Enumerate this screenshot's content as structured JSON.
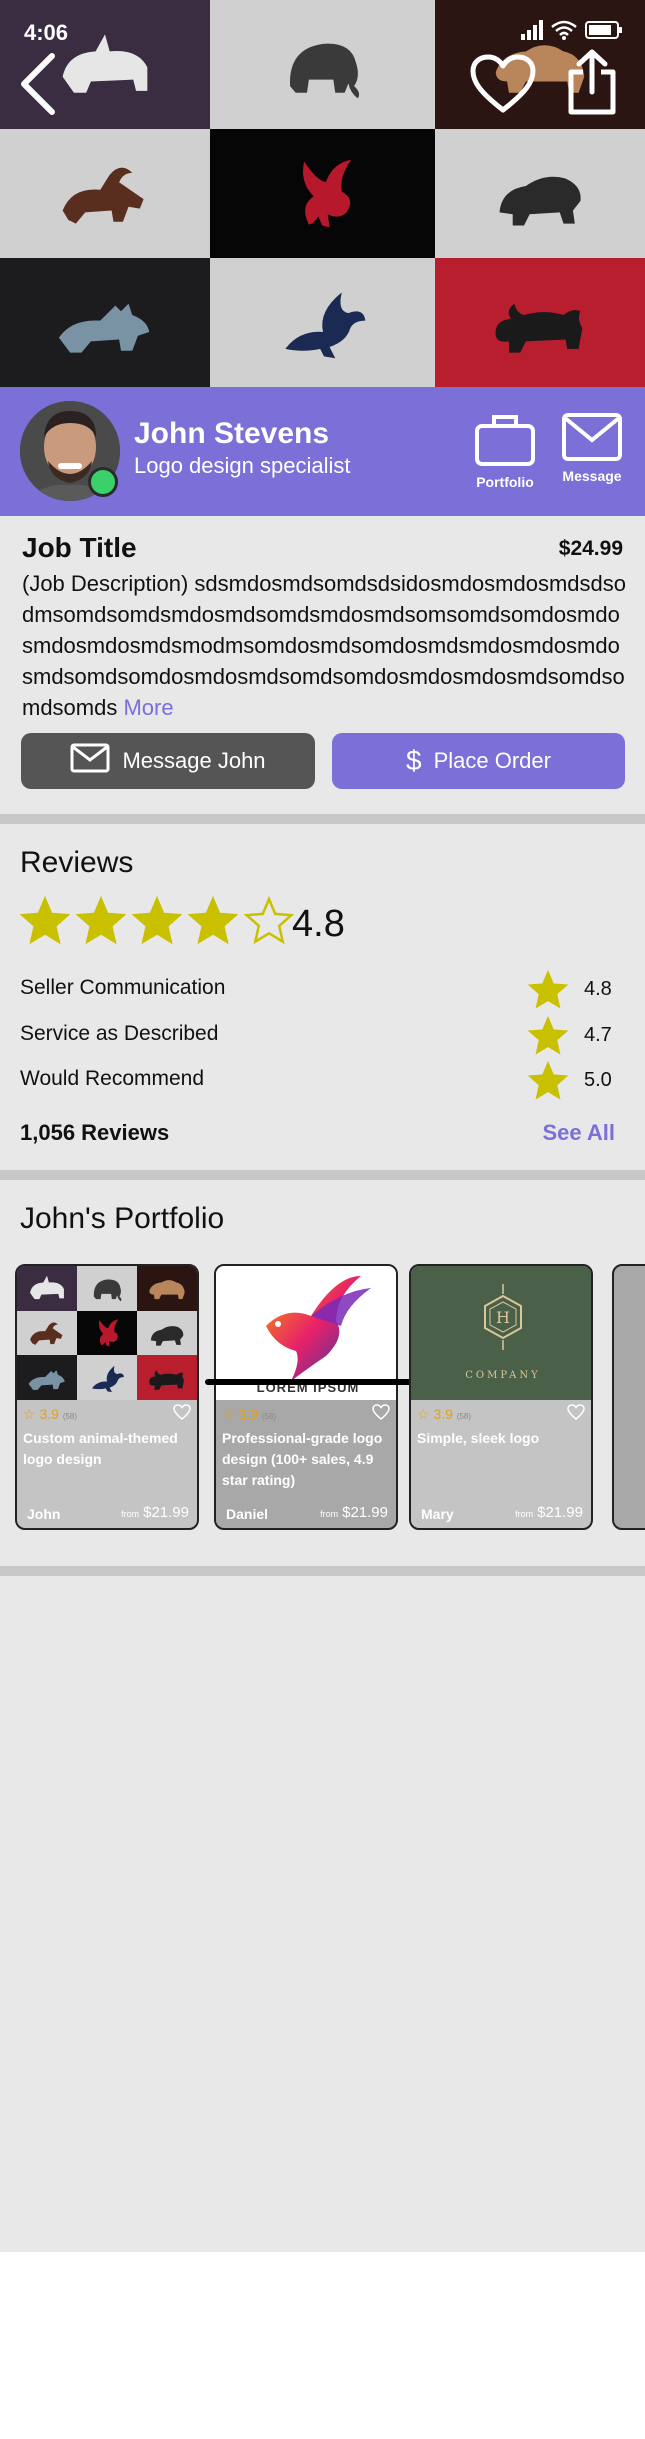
{
  "status": {
    "time": "4:06"
  },
  "hero": {
    "tiles": [
      {
        "name": "rhino",
        "bg": "#3a2d42",
        "fg": "#e6e6e6"
      },
      {
        "name": "mammoth",
        "bg": "#d0d0d0",
        "fg": "#3a3a3a"
      },
      {
        "name": "bison",
        "bg": "#2a1512",
        "fg": "#b8865a"
      },
      {
        "name": "goat",
        "bg": "#d0d0d0",
        "fg": "#5a2e1e"
      },
      {
        "name": "dragon",
        "bg": "#060606",
        "fg": "#b8182c"
      },
      {
        "name": "bear",
        "bg": "#d0d0d0",
        "fg": "#2a2a2a"
      },
      {
        "name": "wolf",
        "bg": "#1c1c1e",
        "fg": "#7a93a4"
      },
      {
        "name": "eagle",
        "bg": "#d0d0d0",
        "fg": "#1a2a52"
      },
      {
        "name": "bull",
        "bg": "#b81e2e",
        "fg": "#1a1a1a"
      }
    ]
  },
  "profile": {
    "name": "John Stevens",
    "title": "Logo design specialist",
    "portfolio_label": "Portfolio",
    "message_label": "Message",
    "accent": "#7b6fd8",
    "online_color": "#3ad16a"
  },
  "job": {
    "title": "Job Title",
    "price": "$24.99",
    "description": "(Job Description) sdsmdosmdsomdsdsidosmdosmdosmdsdsodmsomdsomdsmdosmdsomdsmdosmdsomsomdsomdosmdosmdosmdosmdsmodmsomdosmdsomdosmdsmdosmdosmdosmdsomdsomdosmdosmdsomdsomdosmdosmdosmdsomdsomdsomds",
    "more_label": "More",
    "message_button": "Message John",
    "order_button": "Place Order"
  },
  "reviews": {
    "heading": "Reviews",
    "overall": "4.8",
    "overall_stars": 4.8,
    "star_color": "#c9c000",
    "rows": [
      {
        "label": "Seller Communication",
        "value": "4.8"
      },
      {
        "label": "Service as Described",
        "value": "4.7"
      },
      {
        "label": "Would Recommend",
        "value": "5.0"
      }
    ],
    "count_label": "1,056 Reviews",
    "see_all": "See All"
  },
  "portfolio": {
    "heading": "John's Portfolio",
    "cards": [
      {
        "rating": "3.9",
        "reviews": "(58)",
        "title": "Custom animal-themed logo design",
        "user": "John",
        "from": "from",
        "price": "$21.99"
      },
      {
        "rating": "3.9",
        "reviews": "(58)",
        "title": "Professional-grade logo design (100+ sales, 4.9 star rating)",
        "user": "Daniel",
        "from": "from",
        "price": "$21.99",
        "image_text": "LOREM IPSUM"
      },
      {
        "rating": "3.9",
        "reviews": "(58)",
        "title": "Simple, sleek logo",
        "user": "Mary",
        "from": "from",
        "price": "$21.99",
        "image_text": "COMPANY"
      }
    ]
  }
}
